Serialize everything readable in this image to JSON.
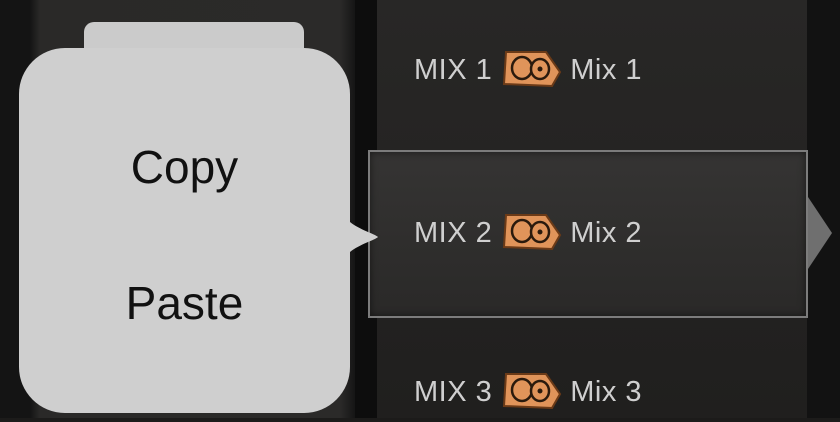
{
  "context_menu": {
    "items": [
      {
        "label": "Copy"
      },
      {
        "label": "Paste"
      }
    ]
  },
  "mix_list": {
    "rows": [
      {
        "id": "MIX 1",
        "name": "Mix 1",
        "icon": "monitor-wedge-icon",
        "selected": false
      },
      {
        "id": "MIX 2",
        "name": "Mix 2",
        "icon": "monitor-wedge-icon",
        "selected": true
      },
      {
        "id": "MIX 3",
        "name": "Mix 3",
        "icon": "monitor-wedge-icon",
        "selected": false
      }
    ]
  },
  "colors": {
    "icon_fill": "#e0945a",
    "menu_bg": "#cfcfcf",
    "text": "#cfcfcf"
  }
}
